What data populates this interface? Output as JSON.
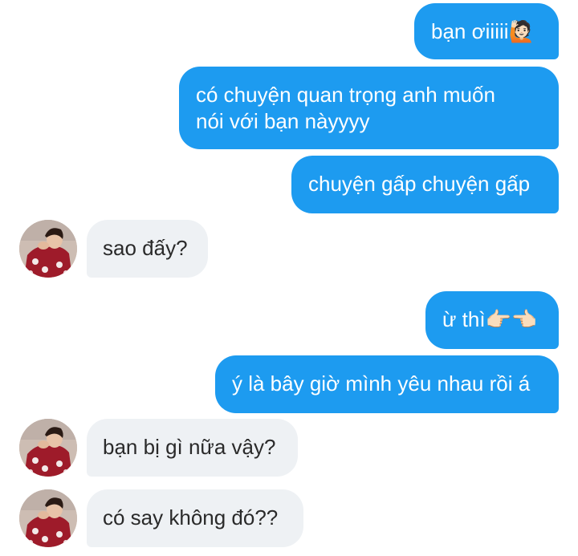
{
  "chat": {
    "messages": [
      {
        "from": "me",
        "text": "bạn ơiiiii🙋🏻"
      },
      {
        "from": "me",
        "text": "có chuyện quan trọng anh muốn\nnói với bạn nàyyyy"
      },
      {
        "from": "me",
        "text": "chuyện gấp chuyện gấp"
      },
      {
        "from": "them",
        "text": "sao đấy?"
      },
      {
        "from": "me",
        "text": "ừ thì👉🏻👈🏻"
      },
      {
        "from": "me",
        "text": "ý là bây giờ mình yêu nhau rồi á"
      },
      {
        "from": "them",
        "text": "bạn bị gì nữa vậy?"
      },
      {
        "from": "them",
        "text": "có say không đó??"
      }
    ]
  },
  "colors": {
    "sent_bubble": "#1d9bf0",
    "received_bubble": "#eef1f4",
    "background": "#ffffff"
  }
}
